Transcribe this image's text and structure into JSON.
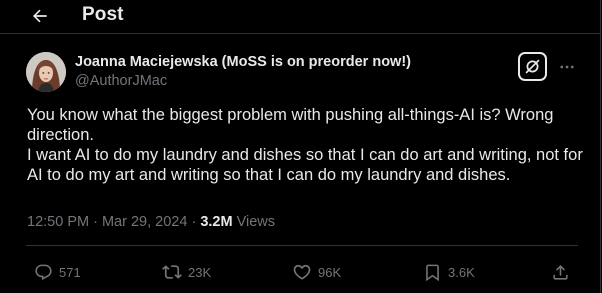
{
  "header": {
    "title": "Post"
  },
  "author": {
    "name": "Joanna Maciejewska (MoSS is on preorder now!)",
    "handle": "@AuthorJMac"
  },
  "tweet": {
    "text": "You know what the biggest problem with pushing all-things-AI is? Wrong direction.\nI want AI to do my laundry and dishes so that I can do art and writing, not for AI to do my art and writing so that I can do my laundry and dishes."
  },
  "meta": {
    "time": "12:50 PM",
    "separator": " · ",
    "date": "Mar 29, 2024",
    "views_count": "3.2M",
    "views_label": " Views"
  },
  "actions": {
    "replies": "571",
    "reposts": "23K",
    "likes": "96K",
    "bookmarks": "3.6K"
  },
  "colors": {
    "background": "#000000",
    "text_primary": "#e7e9ea",
    "text_secondary": "#71767b",
    "divider": "#2f3336"
  }
}
